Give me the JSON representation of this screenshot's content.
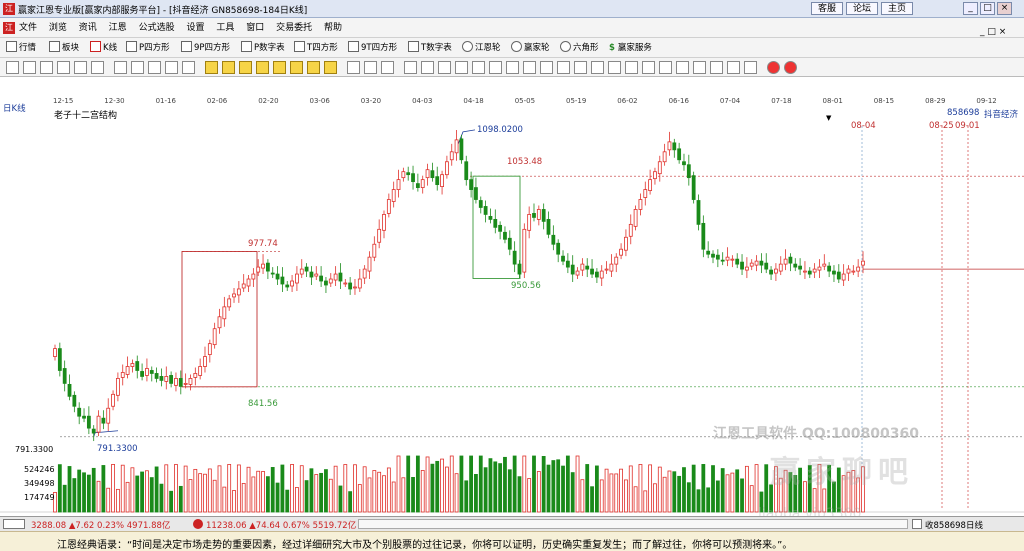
{
  "window": {
    "title": "赢家江恩专业版[赢家内部服务平台] - [抖音经济  GN858698-184日K线]",
    "nav_buttons": [
      "客服",
      "论坛",
      "主页"
    ],
    "win_controls": [
      "_",
      "□",
      "×"
    ]
  },
  "menu": {
    "items": [
      "文件",
      "浏览",
      "资讯",
      "江恩",
      "公式选股",
      "设置",
      "工具",
      "窗口",
      "交易委托",
      "帮助"
    ]
  },
  "toolbar1": {
    "items": [
      "行情",
      "板块",
      "K线",
      "P四方形",
      "9P四方形",
      "P数字表",
      "T四方形",
      "9T四方形",
      "T数字表",
      "江恩轮",
      "赢家轮",
      "六角形",
      "赢家服务"
    ]
  },
  "date_axis": [
    "12-15",
    "12-30",
    "01-16",
    "02-06",
    "02-20",
    "03-06",
    "03-20",
    "04-03",
    "04-18",
    "05-05",
    "05-19",
    "06-02",
    "06-16",
    "07-04",
    "07-18",
    "08-01",
    "08-15",
    "08-29",
    "09-12"
  ],
  "chart": {
    "period_label": "日K线",
    "study_name": "老子十二宫结构",
    "code": "858698",
    "name": "抖音经济",
    "date_marks": [
      "08-04",
      "08-25",
      "09-01"
    ],
    "price_labels": {
      "high": "1098.0200",
      "box2_top": "1053.48",
      "box1_top": "977.74",
      "box2_bottom": "950.56",
      "box1_bottom": "841.56",
      "low": "791.3300",
      "axis_low": "791.3300"
    },
    "volume_labels": [
      "524246",
      "349498",
      "174749"
    ],
    "watermark_line1": "江恩工具软件  QQ:100800360",
    "watermark_line2": "赢家聊吧",
    "watermark_line3": "ljaoba.vip3300",
    "colors": {
      "up": "#e0302a",
      "down": "#1a8a1a",
      "box_red": "#c03030",
      "box_green": "#3a9a3a",
      "label_blue": "#1c3d9a"
    }
  },
  "chart_data": {
    "type": "candlestick",
    "title": "老子十二宫结构",
    "closes": [
      880,
      858,
      845,
      832,
      822,
      812,
      810,
      800,
      795,
      812,
      805,
      820,
      834,
      850,
      856,
      862,
      865,
      858,
      852,
      860,
      855,
      850,
      848,
      852,
      845,
      850,
      842,
      845,
      850,
      855,
      862,
      872,
      885,
      900,
      912,
      922,
      930,
      935,
      940,
      945,
      950,
      955,
      962,
      965,
      958,
      955,
      950,
      945,
      942,
      948,
      955,
      960,
      958,
      952,
      955,
      948,
      944,
      950,
      955,
      948,
      946,
      940,
      942,
      950,
      960,
      972,
      985,
      1000,
      1015,
      1030,
      1040,
      1050,
      1058,
      1055,
      1048,
      1042,
      1050,
      1060,
      1052,
      1045,
      1055,
      1068,
      1078,
      1090,
      1070,
      1050,
      1040,
      1030,
      1022,
      1015,
      1010,
      1002,
      998,
      990,
      980,
      965,
      955,
      1000,
      1015,
      1012,
      1020,
      1008,
      995,
      985,
      975,
      968,
      962,
      955,
      958,
      965,
      960,
      955,
      952,
      958,
      960,
      965,
      972,
      980,
      992,
      1005,
      1020,
      1030,
      1040,
      1050,
      1058,
      1068,
      1078,
      1088,
      1080,
      1070,
      1065,
      1052,
      1030,
      1005,
      980,
      975,
      972,
      970,
      968,
      972,
      970,
      965,
      960,
      962,
      966,
      968,
      964,
      960,
      955,
      960,
      965,
      970,
      966,
      962,
      960,
      958,
      955,
      960,
      962,
      965,
      958,
      955,
      950,
      955,
      960,
      958,
      962,
      968
    ],
    "price_levels": [
      {
        "label": "1098.0200",
        "value": 1098.02
      },
      {
        "label": "1053.48",
        "value": 1053.48
      },
      {
        "label": "977.74",
        "value": 977.74
      },
      {
        "label": "950.56",
        "value": 950.56
      },
      {
        "label": "841.56",
        "value": 841.56
      },
      {
        "label": "791.3300",
        "value": 791.33
      }
    ],
    "volume_axis": [
      524246,
      349498,
      174749
    ]
  },
  "statusbar": {
    "sh_index": "3288.08",
    "sh_change": "▲7.62",
    "sh_pct": "0.23%",
    "sh_amount": "4971.88亿",
    "sz_index": "11238.06",
    "sz_change": "▲74.64",
    "sz_pct": "0.67%",
    "sz_amount": "5519.72亿",
    "right_label": "收858698日线"
  },
  "quote": {
    "text": "江恩经典语录：“时间是决定市场走势的重要因素，经过详细研究大市及个别股票的过往记录，你将可以证明，历史确实重复发生；而了解过往，你将可以预测将来。”。"
  }
}
